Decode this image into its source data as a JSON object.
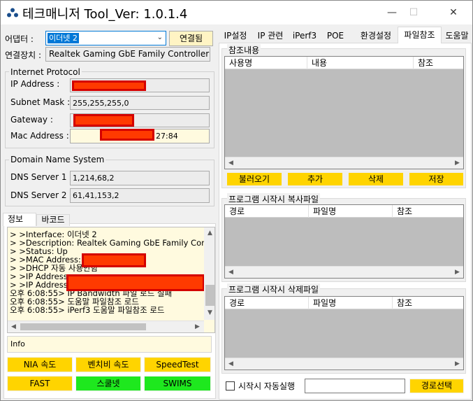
{
  "window": {
    "title": "테크매니저 Tool_Ver: 1.0.1.4",
    "minimize": "—",
    "maximize": "☐",
    "close": "✕"
  },
  "adapter": {
    "label": "어댑터 :",
    "selected": "이더넷 2",
    "connect_button": "연결됨"
  },
  "device": {
    "label": "연결장치 :",
    "value": "Realtek Gaming GbE Family Controller"
  },
  "internet_protocol": {
    "title": "Internet Protocol",
    "ip_label": "IP Address :",
    "subnet_label": "Subnet Mask :",
    "subnet_value": "255,255,255,0",
    "gateway_label": "Gateway :",
    "mac_label": "Mac Address :",
    "mac_suffix": "27:84"
  },
  "dns": {
    "title": "Domain Name System",
    "dns1_label": "DNS Server 1 :",
    "dns1_value": "1,214,68,2",
    "dns2_label": "DNS Server 2 :",
    "dns2_value": "61,41,153,2"
  },
  "left_tabs": [
    "정보",
    "바코드"
  ],
  "log_lines": [
    "> >Interface: 이더넷 2",
    "> >Description: Realtek Gaming GbE Family Controller",
    "> >Status: Up",
    "> >MAC Address:",
    "> >DHCP 자동 사용안함",
    "> >IP Address:",
    "> >IP Address:",
    "오후 6:08:55> IP Bandwidth 파일 로드 실패",
    "오후 6:08:55> 도움말 파일참조 로드",
    "오후 6:08:55> iPerf3 도움말 파일참조 로드"
  ],
  "info_text": "Info",
  "bottom_buttons": {
    "row1": [
      "NIA 속도",
      "벤치비 속도",
      "SpeedTest"
    ],
    "row2": [
      "FAST",
      "스쿨넷",
      "SWIMS"
    ]
  },
  "right_tabs": [
    "IP설정",
    "IP 관련",
    "iPerf3",
    "POE",
    "환경설정",
    "파일참조",
    "도움말"
  ],
  "reference": {
    "title": "참조내용",
    "columns": [
      "사용명",
      "내용",
      "참조"
    ],
    "buttons": [
      "불러오기",
      "추가",
      "삭제",
      "저장"
    ]
  },
  "copy_files": {
    "title": "프로그램 시작시 복사파일",
    "columns": [
      "경로",
      "파일명",
      "참조"
    ]
  },
  "delete_files": {
    "title": "프로그램 시작시 삭제파일",
    "columns": [
      "경로",
      "파일명",
      "참조"
    ]
  },
  "autorun": {
    "label": "시작시 자동실행",
    "path_value": "",
    "select_button": "경로선택"
  },
  "colors": {
    "yellow_button": "#ffd400",
    "green_button": "#1ee81e",
    "redaction": "#ff3a00",
    "field_yellow": "#fffadf"
  }
}
